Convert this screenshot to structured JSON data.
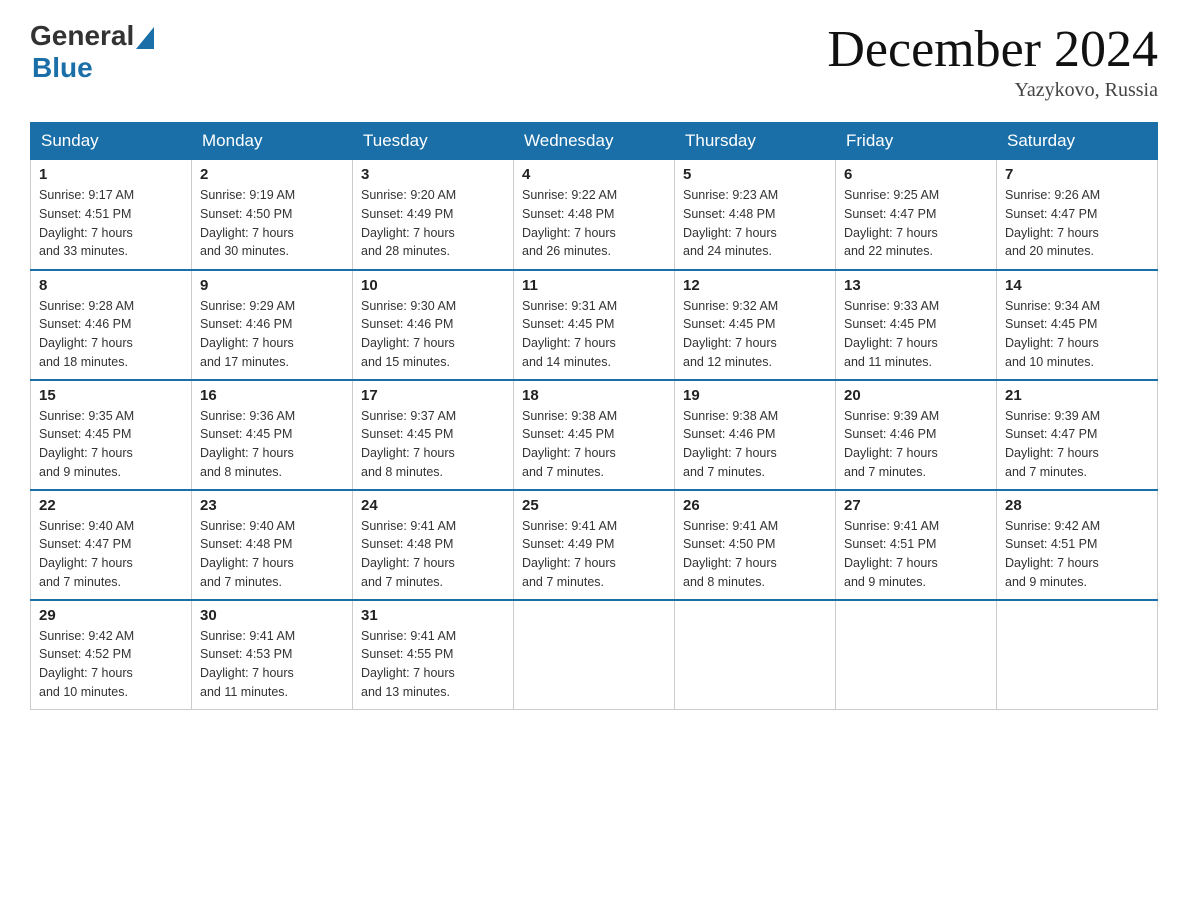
{
  "header": {
    "logo_general": "General",
    "logo_blue": "Blue",
    "title": "December 2024",
    "location": "Yazykovo, Russia"
  },
  "days_of_week": [
    "Sunday",
    "Monday",
    "Tuesday",
    "Wednesday",
    "Thursday",
    "Friday",
    "Saturday"
  ],
  "weeks": [
    [
      {
        "day": "1",
        "sunrise": "9:17 AM",
        "sunset": "4:51 PM",
        "daylight": "7 hours and 33 minutes."
      },
      {
        "day": "2",
        "sunrise": "9:19 AM",
        "sunset": "4:50 PM",
        "daylight": "7 hours and 30 minutes."
      },
      {
        "day": "3",
        "sunrise": "9:20 AM",
        "sunset": "4:49 PM",
        "daylight": "7 hours and 28 minutes."
      },
      {
        "day": "4",
        "sunrise": "9:22 AM",
        "sunset": "4:48 PM",
        "daylight": "7 hours and 26 minutes."
      },
      {
        "day": "5",
        "sunrise": "9:23 AM",
        "sunset": "4:48 PM",
        "daylight": "7 hours and 24 minutes."
      },
      {
        "day": "6",
        "sunrise": "9:25 AM",
        "sunset": "4:47 PM",
        "daylight": "7 hours and 22 minutes."
      },
      {
        "day": "7",
        "sunrise": "9:26 AM",
        "sunset": "4:47 PM",
        "daylight": "7 hours and 20 minutes."
      }
    ],
    [
      {
        "day": "8",
        "sunrise": "9:28 AM",
        "sunset": "4:46 PM",
        "daylight": "7 hours and 18 minutes."
      },
      {
        "day": "9",
        "sunrise": "9:29 AM",
        "sunset": "4:46 PM",
        "daylight": "7 hours and 17 minutes."
      },
      {
        "day": "10",
        "sunrise": "9:30 AM",
        "sunset": "4:46 PM",
        "daylight": "7 hours and 15 minutes."
      },
      {
        "day": "11",
        "sunrise": "9:31 AM",
        "sunset": "4:45 PM",
        "daylight": "7 hours and 14 minutes."
      },
      {
        "day": "12",
        "sunrise": "9:32 AM",
        "sunset": "4:45 PM",
        "daylight": "7 hours and 12 minutes."
      },
      {
        "day": "13",
        "sunrise": "9:33 AM",
        "sunset": "4:45 PM",
        "daylight": "7 hours and 11 minutes."
      },
      {
        "day": "14",
        "sunrise": "9:34 AM",
        "sunset": "4:45 PM",
        "daylight": "7 hours and 10 minutes."
      }
    ],
    [
      {
        "day": "15",
        "sunrise": "9:35 AM",
        "sunset": "4:45 PM",
        "daylight": "7 hours and 9 minutes."
      },
      {
        "day": "16",
        "sunrise": "9:36 AM",
        "sunset": "4:45 PM",
        "daylight": "7 hours and 8 minutes."
      },
      {
        "day": "17",
        "sunrise": "9:37 AM",
        "sunset": "4:45 PM",
        "daylight": "7 hours and 8 minutes."
      },
      {
        "day": "18",
        "sunrise": "9:38 AM",
        "sunset": "4:45 PM",
        "daylight": "7 hours and 7 minutes."
      },
      {
        "day": "19",
        "sunrise": "9:38 AM",
        "sunset": "4:46 PM",
        "daylight": "7 hours and 7 minutes."
      },
      {
        "day": "20",
        "sunrise": "9:39 AM",
        "sunset": "4:46 PM",
        "daylight": "7 hours and 7 minutes."
      },
      {
        "day": "21",
        "sunrise": "9:39 AM",
        "sunset": "4:47 PM",
        "daylight": "7 hours and 7 minutes."
      }
    ],
    [
      {
        "day": "22",
        "sunrise": "9:40 AM",
        "sunset": "4:47 PM",
        "daylight": "7 hours and 7 minutes."
      },
      {
        "day": "23",
        "sunrise": "9:40 AM",
        "sunset": "4:48 PM",
        "daylight": "7 hours and 7 minutes."
      },
      {
        "day": "24",
        "sunrise": "9:41 AM",
        "sunset": "4:48 PM",
        "daylight": "7 hours and 7 minutes."
      },
      {
        "day": "25",
        "sunrise": "9:41 AM",
        "sunset": "4:49 PM",
        "daylight": "7 hours and 7 minutes."
      },
      {
        "day": "26",
        "sunrise": "9:41 AM",
        "sunset": "4:50 PM",
        "daylight": "7 hours and 8 minutes."
      },
      {
        "day": "27",
        "sunrise": "9:41 AM",
        "sunset": "4:51 PM",
        "daylight": "7 hours and 9 minutes."
      },
      {
        "day": "28",
        "sunrise": "9:42 AM",
        "sunset": "4:51 PM",
        "daylight": "7 hours and 9 minutes."
      }
    ],
    [
      {
        "day": "29",
        "sunrise": "9:42 AM",
        "sunset": "4:52 PM",
        "daylight": "7 hours and 10 minutes."
      },
      {
        "day": "30",
        "sunrise": "9:41 AM",
        "sunset": "4:53 PM",
        "daylight": "7 hours and 11 minutes."
      },
      {
        "day": "31",
        "sunrise": "9:41 AM",
        "sunset": "4:55 PM",
        "daylight": "7 hours and 13 minutes."
      },
      null,
      null,
      null,
      null
    ]
  ]
}
